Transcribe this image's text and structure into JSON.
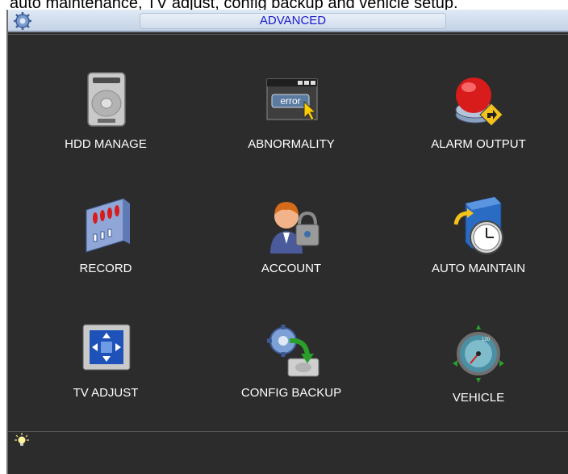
{
  "caption_text": "auto maintenance, TV adjust, config backup and vehicle setup.",
  "window": {
    "title": "ADVANCED"
  },
  "icons": {
    "app": "gear-icon",
    "status": "lightbulb-icon"
  },
  "tiles": [
    {
      "label": "HDD MANAGE",
      "icon": "hdd-icon"
    },
    {
      "label": "ABNORMALITY",
      "icon": "error-window-icon"
    },
    {
      "label": "ALARM OUTPUT",
      "icon": "alarm-button-icon"
    },
    {
      "label": "RECORD",
      "icon": "record-icon"
    },
    {
      "label": "ACCOUNT",
      "icon": "account-icon"
    },
    {
      "label": "AUTO MAINTAIN",
      "icon": "auto-maintain-icon"
    },
    {
      "label": "TV ADJUST",
      "icon": "tv-adjust-icon"
    },
    {
      "label": "CONFIG BACKUP",
      "icon": "config-backup-icon"
    },
    {
      "label": "VEHICLE",
      "icon": "speedometer-icon"
    }
  ],
  "colors": {
    "background": "#2c2c2c",
    "title_text": "#1a1acc",
    "label_text": "#ffffff"
  }
}
